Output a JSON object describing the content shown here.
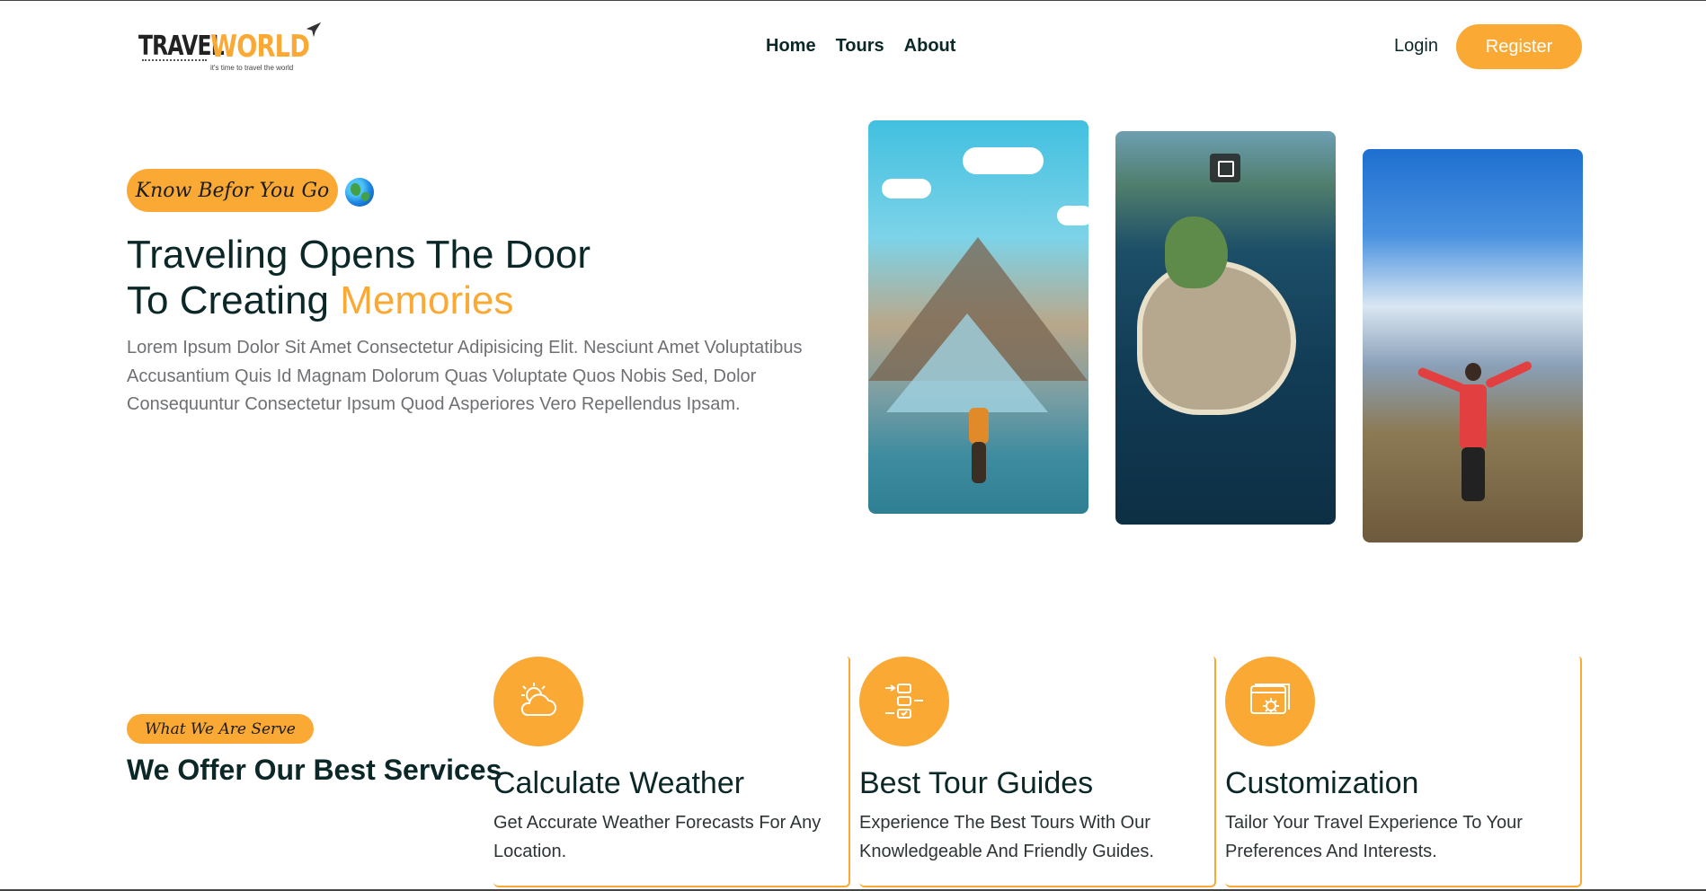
{
  "header": {
    "logo": {
      "part1": "TRAVEL",
      "part2": "WORLD",
      "tagline": "it's time to travel the world",
      "plane_icon": "plane-icon"
    },
    "nav": [
      "Home",
      "Tours",
      "About"
    ],
    "login_label": "Login",
    "register_label": "Register"
  },
  "hero": {
    "subtitle": "Know Befor You Go",
    "globe_icon": "globe-icon",
    "title_line1": "Traveling Opens The Door",
    "title_line2_prefix": "To Creating ",
    "title_highlight": "Memories",
    "description": "Lorem Ipsum Dolor Sit Amet Consectetur Adipisicing Elit. Nesciunt Amet Voluptatibus Accusantium Quis Id Magnam Dolorum Quas Voluptate Quos Nobis Sed, Dolor Consequuntur Consectetur Ipsum Quod Asperiores Vero Repellendus Ipsam.",
    "images": [
      "louvre-photo",
      "island-fort-photo",
      "hiker-photo"
    ]
  },
  "services": {
    "subtitle": "What We Are Serve",
    "title": "We Offer Our Best Services",
    "cards": [
      {
        "icon": "weather-icon",
        "title": "Calculate Weather",
        "desc": "Get Accurate Weather Forecasts For Any Location."
      },
      {
        "icon": "guide-icon",
        "title": "Best Tour Guides",
        "desc": "Experience The Best Tours With Our Knowledgeable And Friendly Guides."
      },
      {
        "icon": "customization-icon",
        "title": "Customization",
        "desc": "Tailor Your Travel Experience To Your Preferences And Interests."
      }
    ]
  },
  "colors": {
    "accent": "#faa935",
    "heading": "#0b2727",
    "text": "#6e7074"
  }
}
